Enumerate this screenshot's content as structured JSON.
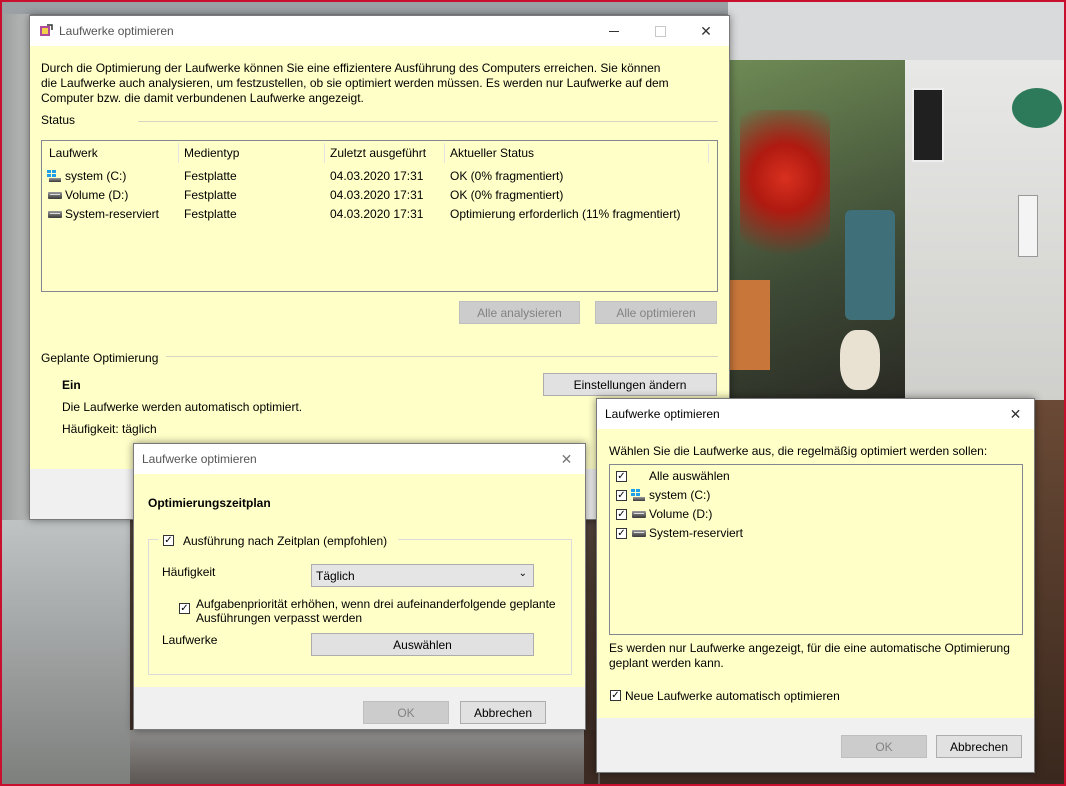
{
  "main_window": {
    "title": "Laufwerke optimieren",
    "description": "Durch die Optimierung der Laufwerke können Sie eine effizientere Ausführung des Computers erreichen. Sie können die Laufwerke auch analysieren, um festzustellen, ob sie optimiert werden müssen. Es werden nur Laufwerke auf dem Computer bzw. die damit verbundenen Laufwerke angezeigt.",
    "description_lines": [
      "Durch die Optimierung der Laufwerke können Sie eine effizientere Ausführung des Computers erreichen. Sie können",
      "die Laufwerke auch analysieren, um festzustellen, ob sie optimiert werden müssen. Es werden nur Laufwerke auf dem",
      "Computer bzw. die damit verbundenen Laufwerke angezeigt."
    ],
    "status_label": "Status",
    "columns": [
      "Laufwerk",
      "Medientyp",
      "Zuletzt ausgeführt",
      "Aktueller Status"
    ],
    "drives": [
      {
        "icon": "windows-drive-icon",
        "name": "system (C:)",
        "media": "Festplatte",
        "last_run": "04.03.2020 17:31",
        "status": "OK (0% fragmentiert)"
      },
      {
        "icon": "hard-drive-icon",
        "name": "Volume (D:)",
        "media": "Festplatte",
        "last_run": "04.03.2020 17:31",
        "status": "OK (0% fragmentiert)"
      },
      {
        "icon": "hard-drive-icon",
        "name": "System-reserviert",
        "media": "Festplatte",
        "last_run": "04.03.2020 17:31",
        "status": "Optimierung erforderlich (11% fragmentiert)"
      }
    ],
    "analyze_all": "Alle analysieren",
    "optimize_all": "Alle optimieren",
    "scheduled_label": "Geplante Optimierung",
    "scheduled_state": "Ein",
    "scheduled_desc": "Die Laufwerke werden automatisch optimiert.",
    "frequency_text": "Häufigkeit: täglich",
    "change_settings": "Einstellungen ändern"
  },
  "schedule_dialog": {
    "title": "Laufwerke optimieren",
    "heading": "Optimierungszeitplan",
    "run_on_schedule": "Ausführung nach Zeitplan (empfohlen)",
    "run_on_schedule_checked": true,
    "frequency_label": "Häufigkeit",
    "frequency_value": "Täglich",
    "priority_lines": [
      "Aufgabenpriorität erhöhen, wenn drei aufeinanderfolgende geplante",
      "Ausführungen verpasst werden"
    ],
    "priority_checked": true,
    "drives_label": "Laufwerke",
    "choose_button": "Auswählen",
    "ok": "OK",
    "cancel": "Abbrechen"
  },
  "select_dialog": {
    "title": "Laufwerke optimieren",
    "instruction": "Wählen Sie die Laufwerke aus, die regelmäßig optimiert werden sollen:",
    "items": [
      {
        "label": "Alle auswählen",
        "checked": true,
        "icon": ""
      },
      {
        "label": "system (C:)",
        "checked": true,
        "icon": "windows-drive-icon"
      },
      {
        "label": "Volume (D:)",
        "checked": true,
        "icon": "hard-drive-icon"
      },
      {
        "label": "System-reserviert",
        "checked": true,
        "icon": "hard-drive-icon"
      }
    ],
    "note_lines": [
      "Es werden nur Laufwerke angezeigt, für die eine automatische Optimierung",
      "geplant werden kann."
    ],
    "auto_new": "Neue Laufwerke automatisch optimieren",
    "auto_new_checked": true,
    "ok": "OK",
    "cancel": "Abbrechen"
  },
  "colors": {
    "window_bg": "#ffffc8",
    "title_bg": "#ffffff",
    "accent": "#0078d7",
    "desktop_border": "#c8102e"
  }
}
